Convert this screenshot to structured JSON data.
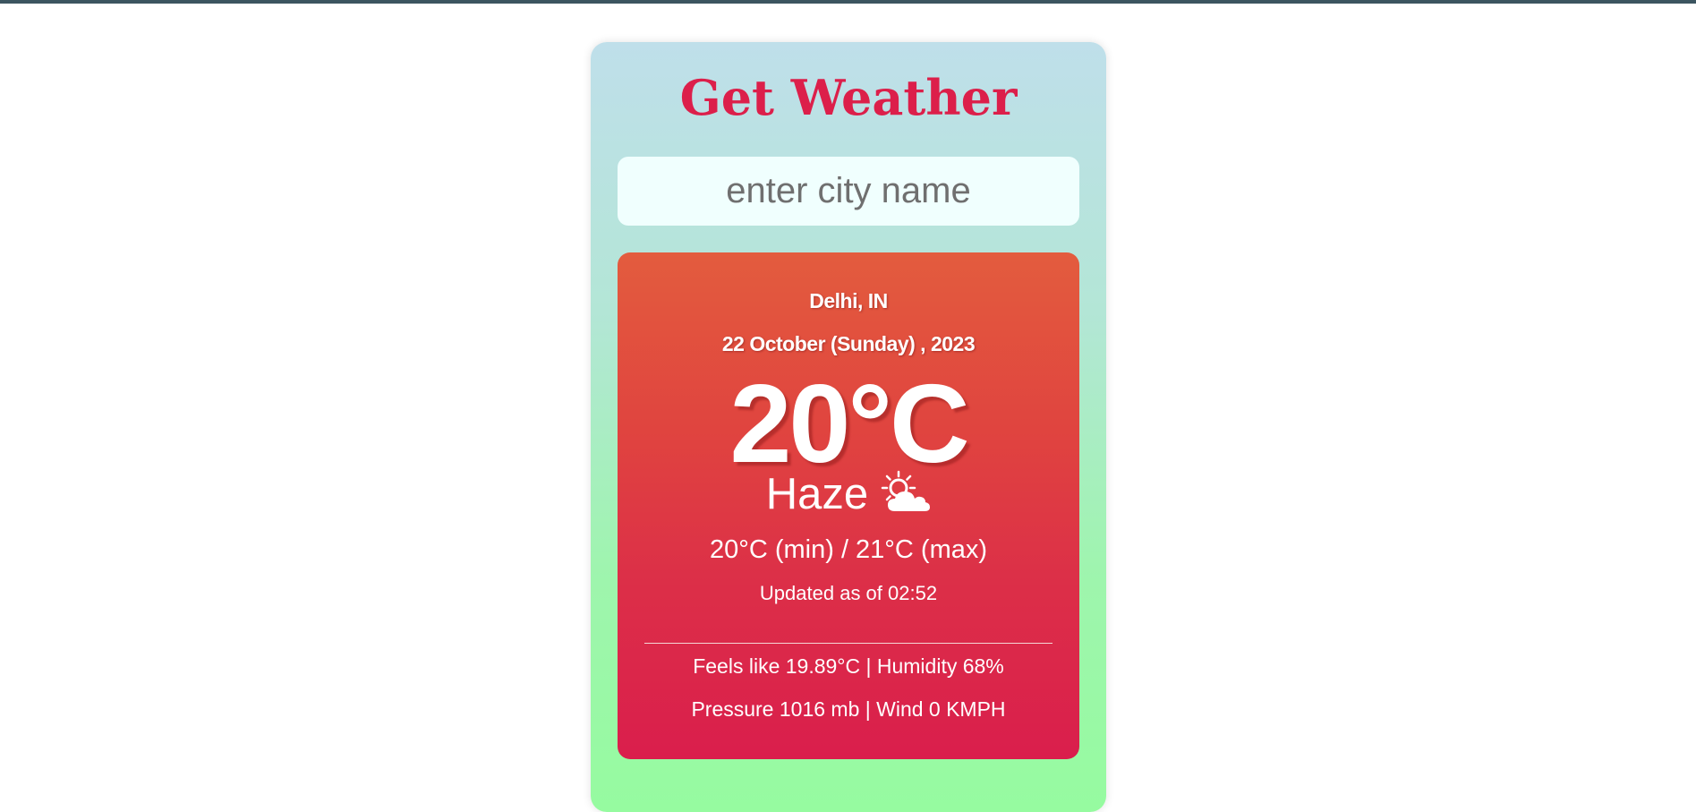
{
  "app": {
    "title": "Get Weather"
  },
  "search": {
    "placeholder": "enter city name",
    "value": ""
  },
  "weather": {
    "location": "Delhi, IN",
    "date": "22 October (Sunday) , 2023",
    "temperature": "20°C",
    "condition": "Haze",
    "condition_icon": "sun-behind-cloud-icon",
    "min_max": "20°C (min) / 21°C (max)",
    "updated": "Updated as of 02:52",
    "details_line1": "Feels like 19.89°C | Humidity 68%",
    "details_line2": "Pressure 1016 mb | Wind 0 KMPH"
  },
  "colors": {
    "title": "#dc1f4a",
    "card_gradient_top": "#bfdfea",
    "card_gradient_bottom": "#96fba0",
    "weather_gradient_top": "#e35c3e",
    "weather_gradient_bottom": "#da1e4c",
    "search_background": "#f0fffe"
  }
}
